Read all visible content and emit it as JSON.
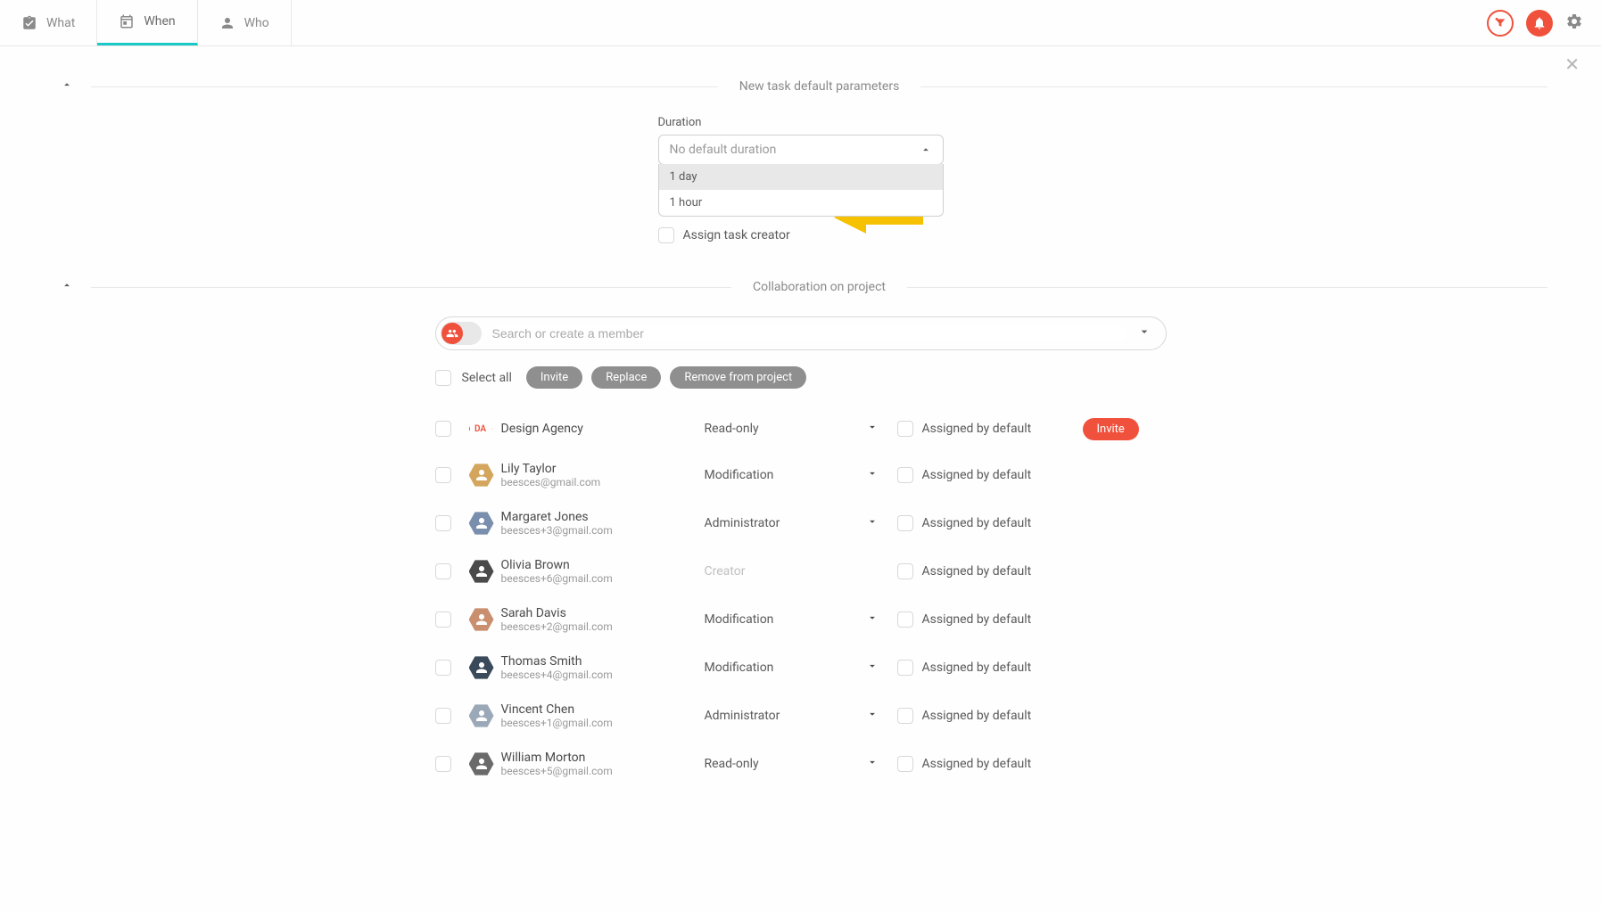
{
  "tabs": {
    "what": "What",
    "when": "When",
    "who": "Who"
  },
  "sections": {
    "defaults_title": "New task default parameters",
    "collab_title": "Collaboration on project"
  },
  "duration": {
    "label": "Duration",
    "placeholder": "No default duration",
    "options": [
      "1 day",
      "1 hour"
    ]
  },
  "assign_creator_label": "Assign task creator",
  "search": {
    "placeholder": "Search or create a member"
  },
  "actions": {
    "select_all": "Select all",
    "invite": "Invite",
    "replace": "Replace",
    "remove": "Remove from project"
  },
  "assigned_label": "Assigned by default",
  "invite_label": "Invite",
  "members": [
    {
      "initials": "DA",
      "name": "Design Agency",
      "email": "",
      "role": "Read-only",
      "role_muted": false,
      "role_chev": true,
      "invite": true,
      "da": true
    },
    {
      "name": "Lily Taylor",
      "email": "beesces@gmail.com",
      "role": "Modification",
      "role_muted": false,
      "role_chev": true,
      "invite": false
    },
    {
      "name": "Margaret Jones",
      "email": "beesces+3@gmail.com",
      "role": "Administrator",
      "role_muted": false,
      "role_chev": true,
      "invite": false
    },
    {
      "name": "Olivia Brown",
      "email": "beesces+6@gmail.com",
      "role": "Creator",
      "role_muted": true,
      "role_chev": false,
      "invite": false
    },
    {
      "name": "Sarah Davis",
      "email": "beesces+2@gmail.com",
      "role": "Modification",
      "role_muted": false,
      "role_chev": true,
      "invite": false
    },
    {
      "name": "Thomas Smith",
      "email": "beesces+4@gmail.com",
      "role": "Modification",
      "role_muted": false,
      "role_chev": true,
      "invite": false
    },
    {
      "name": "Vincent Chen",
      "email": "beesces+1@gmail.com",
      "role": "Administrator",
      "role_muted": false,
      "role_chev": true,
      "invite": false
    },
    {
      "name": "William Morton",
      "email": "beesces+5@gmail.com",
      "role": "Read-only",
      "role_muted": false,
      "role_chev": true,
      "invite": false
    }
  ],
  "avatar_colors": [
    "#f0513c",
    "#d4a55c",
    "#7a8fae",
    "#4a4a4a",
    "#c98f6f",
    "#3a4a5a",
    "#9aa8b8",
    "#6a6a6a"
  ]
}
